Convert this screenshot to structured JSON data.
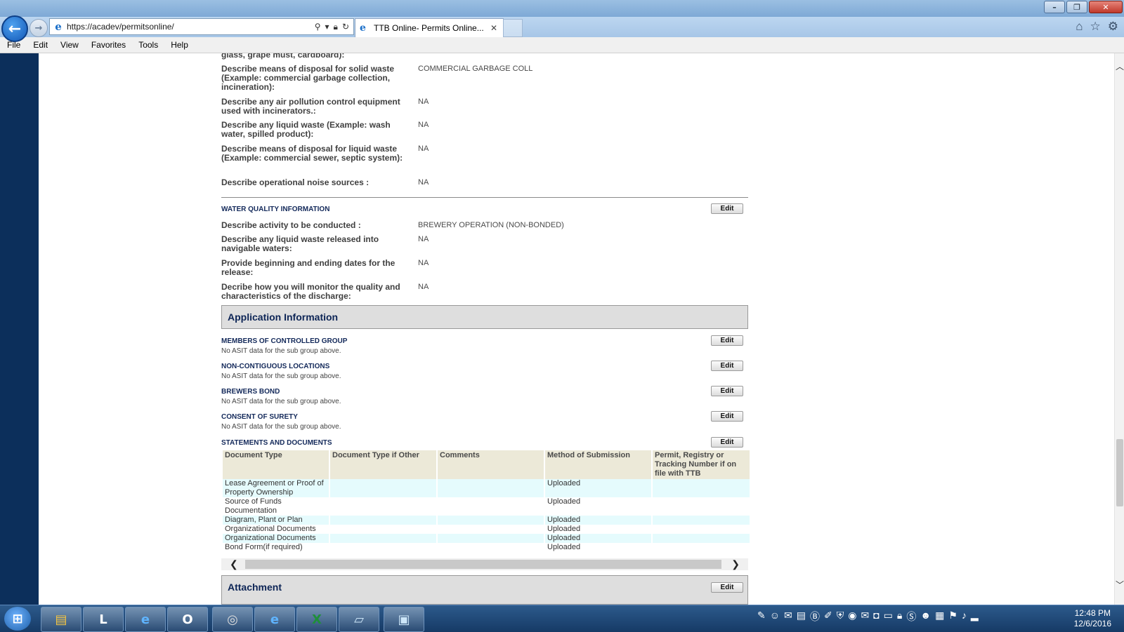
{
  "browser": {
    "url": "https://acadev/permitsonline/",
    "tab_title": "TTB Online- Permits Online...",
    "menu": [
      "File",
      "Edit",
      "View",
      "Favorites",
      "Tools",
      "Help"
    ]
  },
  "environmental": {
    "cutoff_label": "glass, grape must, cardboard):",
    "rows": [
      {
        "label": "Describe means of disposal for solid waste (Example: commercial garbage collection, incineration):",
        "value": "COMMERCIAL GARBAGE COLL"
      },
      {
        "label": "Describe any air pollution control equipment used with incinerators.:",
        "value": "NA"
      },
      {
        "label": "Describe any liquid waste (Example: wash water, spilled product):",
        "value": "NA"
      },
      {
        "label": "Describe means of disposal for liquid waste (Example: commercial sewer, septic system):",
        "value": "NA"
      },
      {
        "label": "Describe operational noise sources :",
        "value": "NA"
      }
    ]
  },
  "water_quality": {
    "title": "WATER QUALITY INFORMATION",
    "edit": "Edit",
    "rows": [
      {
        "label": "Describe activity to be conducted :",
        "value": "BREWERY OPERATION (NON-BONDED)"
      },
      {
        "label": "Describe any liquid waste released into navigable waters:",
        "value": "NA"
      },
      {
        "label": "Provide beginning and ending dates for the release:",
        "value": "NA"
      },
      {
        "label": "Decribe how you will monitor the quality and characteristics of the discharge:",
        "value": "NA"
      }
    ]
  },
  "application_info": {
    "title": "Application Information",
    "groups": [
      {
        "title": "MEMBERS OF CONTROLLED GROUP",
        "note": "No ASIT data for the sub group above.",
        "edit": "Edit"
      },
      {
        "title": "NON-CONTIGUOUS LOCATIONS",
        "note": "No ASIT data for the sub group above.",
        "edit": "Edit"
      },
      {
        "title": "BREWERS BOND",
        "note": "No ASIT data for the sub group above.",
        "edit": "Edit"
      },
      {
        "title": "CONSENT OF SURETY",
        "note": "No ASIT data for the sub group above.",
        "edit": "Edit"
      }
    ],
    "statements": {
      "title": "STATEMENTS AND DOCUMENTS",
      "edit": "Edit",
      "columns": [
        "Document Type",
        "Document Type if Other",
        "Comments",
        "Method of Submission",
        "Permit, Registry or Tracking Number if on file with TTB"
      ],
      "rows": [
        [
          "Lease Agreement or Proof of Property Ownership",
          "",
          "",
          "Uploaded",
          ""
        ],
        [
          "Source of Funds Documentation",
          "",
          "",
          "Uploaded",
          ""
        ],
        [
          "Diagram, Plant or Plan",
          "",
          "",
          "Uploaded",
          ""
        ],
        [
          "Organizational Documents",
          "",
          "",
          "Uploaded",
          ""
        ],
        [
          "Organizational Documents",
          "",
          "",
          "Uploaded",
          ""
        ],
        [
          "Bond Form(if required)",
          "",
          "",
          "Uploaded",
          ""
        ]
      ]
    }
  },
  "attachment": {
    "title": "Attachment",
    "edit": "Edit"
  },
  "taskbar": {
    "apps": [
      "explorer",
      "lync",
      "internet-explorer",
      "outlook",
      "app-circle",
      "internet-explorer",
      "excel",
      "notepad",
      "photo-viewer"
    ],
    "time": "12:48 PM",
    "date": "12/6/2016"
  }
}
